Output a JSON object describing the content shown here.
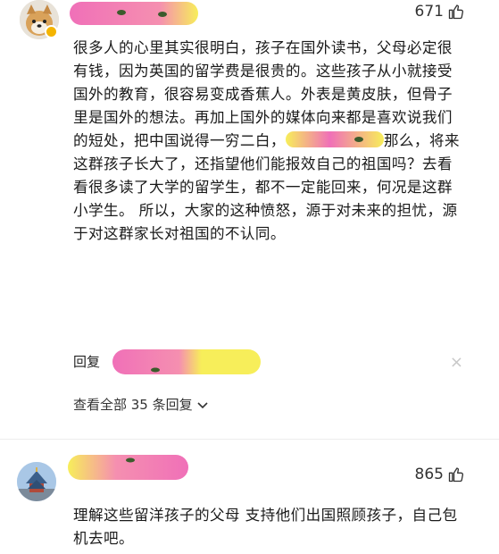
{
  "comment1": {
    "likes": "671",
    "text_a": "很多人的心里其实很明白，孩子在国外读书，父母必定很有钱，因为英国的留学费是很贵的。这些孩子从小就接受国外的教育，很容易变成香蕉人。外表是黄皮肤，但骨子里是国外的想法。再加上国外的媒体向来都是喜欢说我们的短处，把中国说得一穷二白，",
    "text_b": "那么，将来这群孩子长大了，还指望他们能报效自己的祖国吗？去看看很多读了大学的留学生，都不一定能回来，何况是这群小学生。 所以，大家的这种愤怒，源于对未来的担忧，源于对这群家长对祖国的不认同。",
    "reply_label": "回复",
    "close_glyph": "×",
    "view_all_replies": "查看全部 35 条回复"
  },
  "comment2": {
    "likes": "865",
    "text": "理解这些留洋孩子的父母 支持他们出国照顾孩子，自己包机去吧。"
  },
  "colors": {
    "highlight_pink": "#f070b8",
    "highlight_yellow": "#f7ee5a",
    "text": "#1a1a1a",
    "muted": "#666666"
  }
}
